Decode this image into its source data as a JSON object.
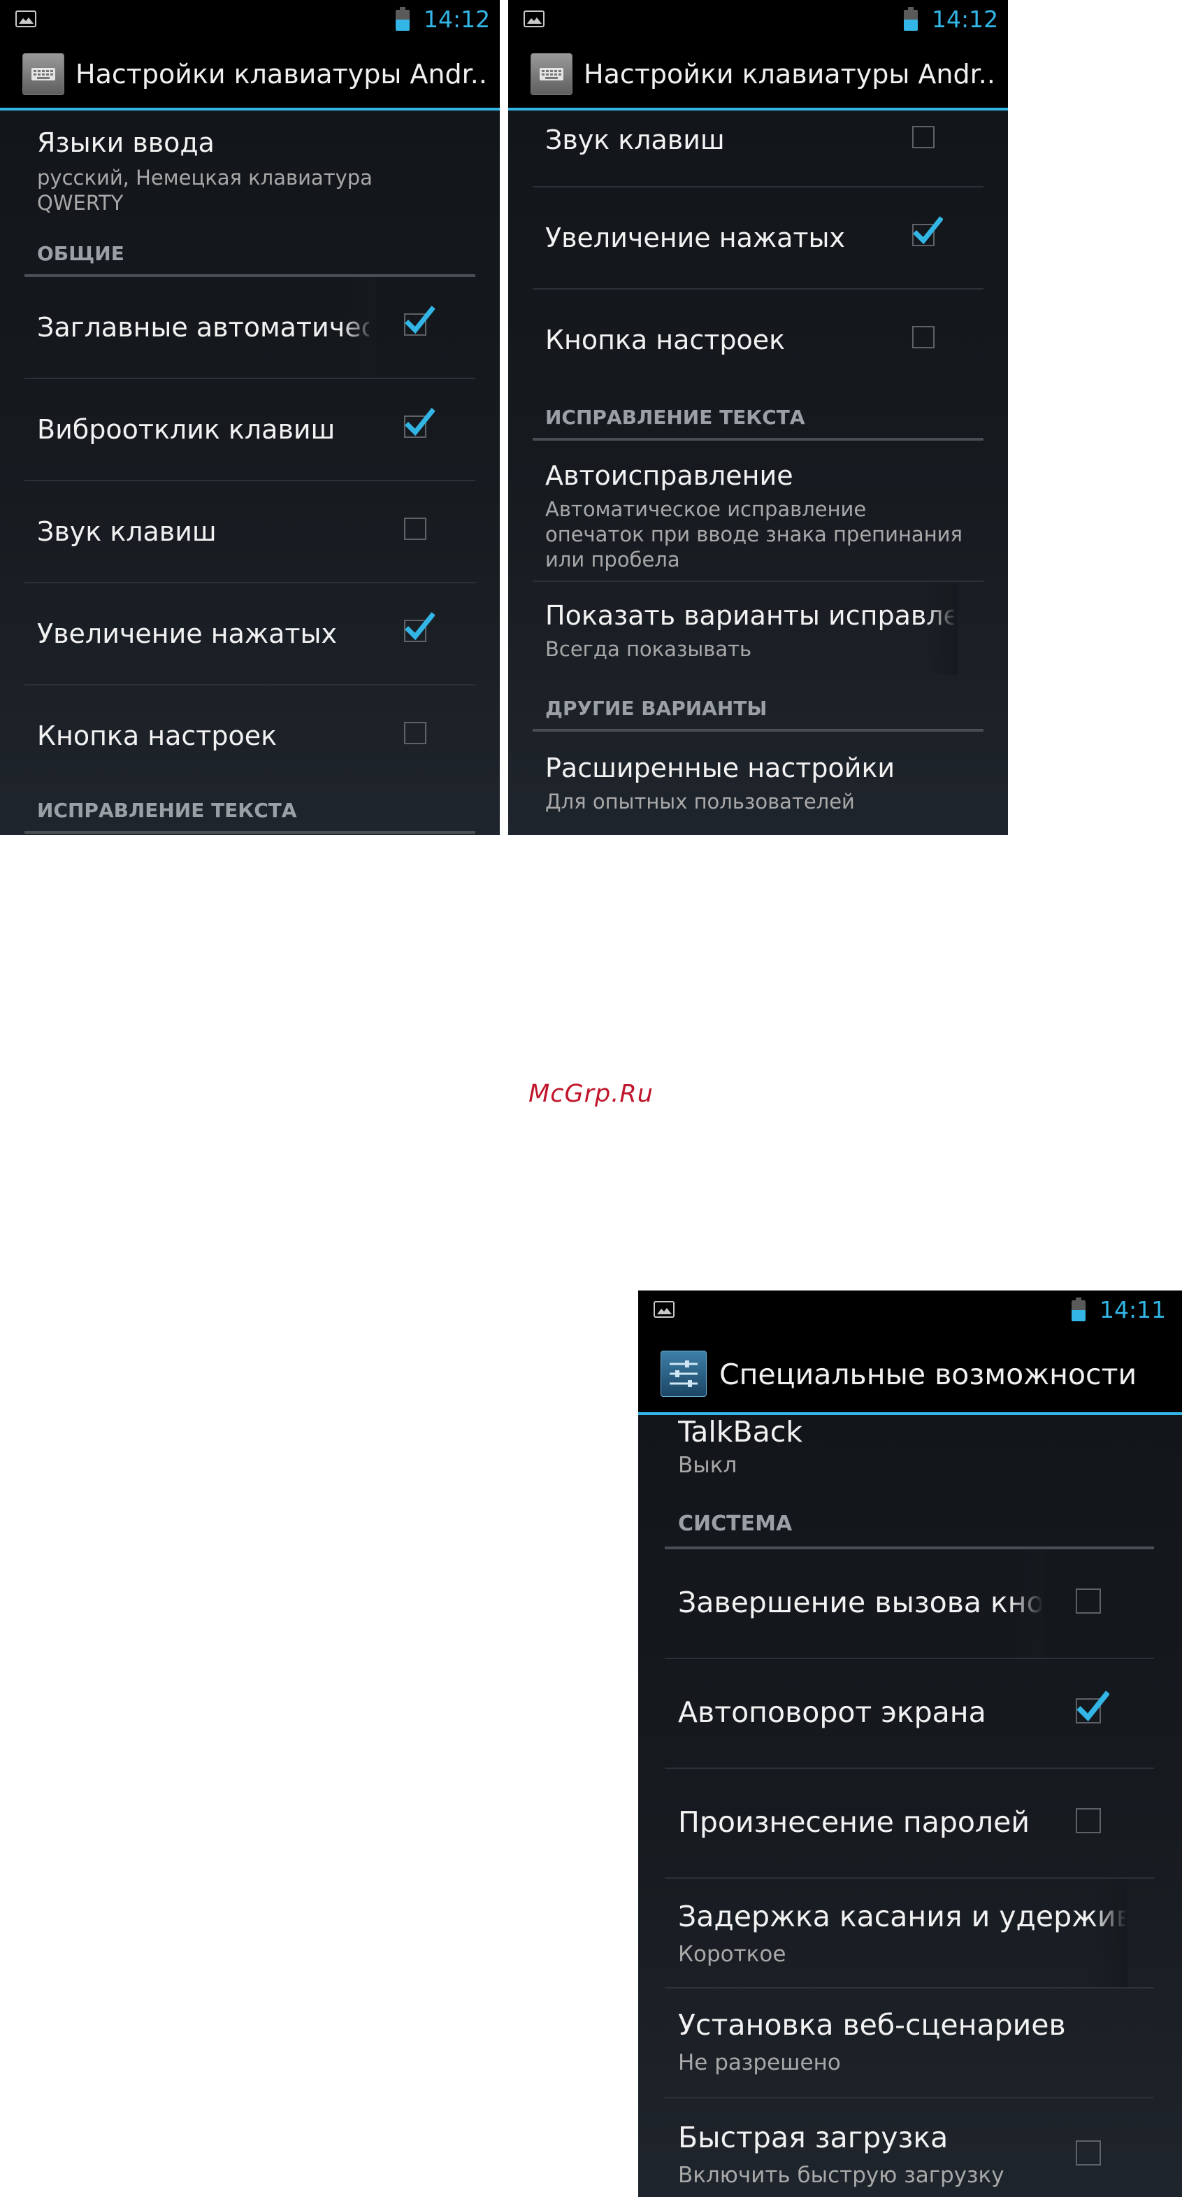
{
  "status": {
    "time_left": "14:12",
    "time_mid": "14:12",
    "time_bottom": "14:11"
  },
  "screens": {
    "keyboard_title": "Настройки клавиатуры Andr...",
    "accessibility_title": "Специальные возможности"
  },
  "screen1": {
    "languages_title": "Языки ввода",
    "languages_summary": "русский, Немецкая клавиатура QWERTY",
    "cat_general": "ОБЩИЕ",
    "auto_caps": "Заглавные автоматически",
    "vibrate": "Виброотклик клавиш",
    "sound": "Звук клавиш",
    "popup": "Увеличение нажатых",
    "settings_key": "Кнопка настроек",
    "cat_correction": "ИСПРАВЛЕНИЕ ТЕКСТА"
  },
  "screen2": {
    "sound": "Звук клавиш",
    "popup": "Увеличение нажатых",
    "settings_key": "Кнопка настроек",
    "cat_correction": "ИСПРАВЛЕНИЕ ТЕКСТА",
    "autocorrect_title": "Автоисправление",
    "autocorrect_summary": "Автоматическое исправление опечаток при вводе знака препинания или пробела",
    "suggestions_title": "Показать варианты исправления",
    "suggestions_summary": "Всегда показывать",
    "cat_other": "ДРУГИЕ ВАРИАНТЫ",
    "advanced_title": "Расширенные настройки",
    "advanced_summary": "Для опытных пользователей"
  },
  "screen3": {
    "talkback_title": "TalkBack",
    "talkback_summary": "Выкл",
    "cat_system": "СИСТЕМА",
    "power_end_call": "Завершение вызова кнопкой питания",
    "auto_rotate": "Автоповорот экрана",
    "speak_passwords": "Произнесение паролей",
    "touch_hold_title": "Задержка касания и удерживания",
    "touch_hold_summary": "Короткое",
    "web_scripts_title": "Установка веб-сценариев",
    "web_scripts_summary": "Не разрешено",
    "quick_boot_title": "Быстрая загрузка",
    "quick_boot_summary": "Включить быструю загрузку"
  },
  "watermark": "McGrp.Ru",
  "colors": {
    "accent": "#33b5e5",
    "watermark": "#c0152a",
    "background": "#161a1f"
  }
}
